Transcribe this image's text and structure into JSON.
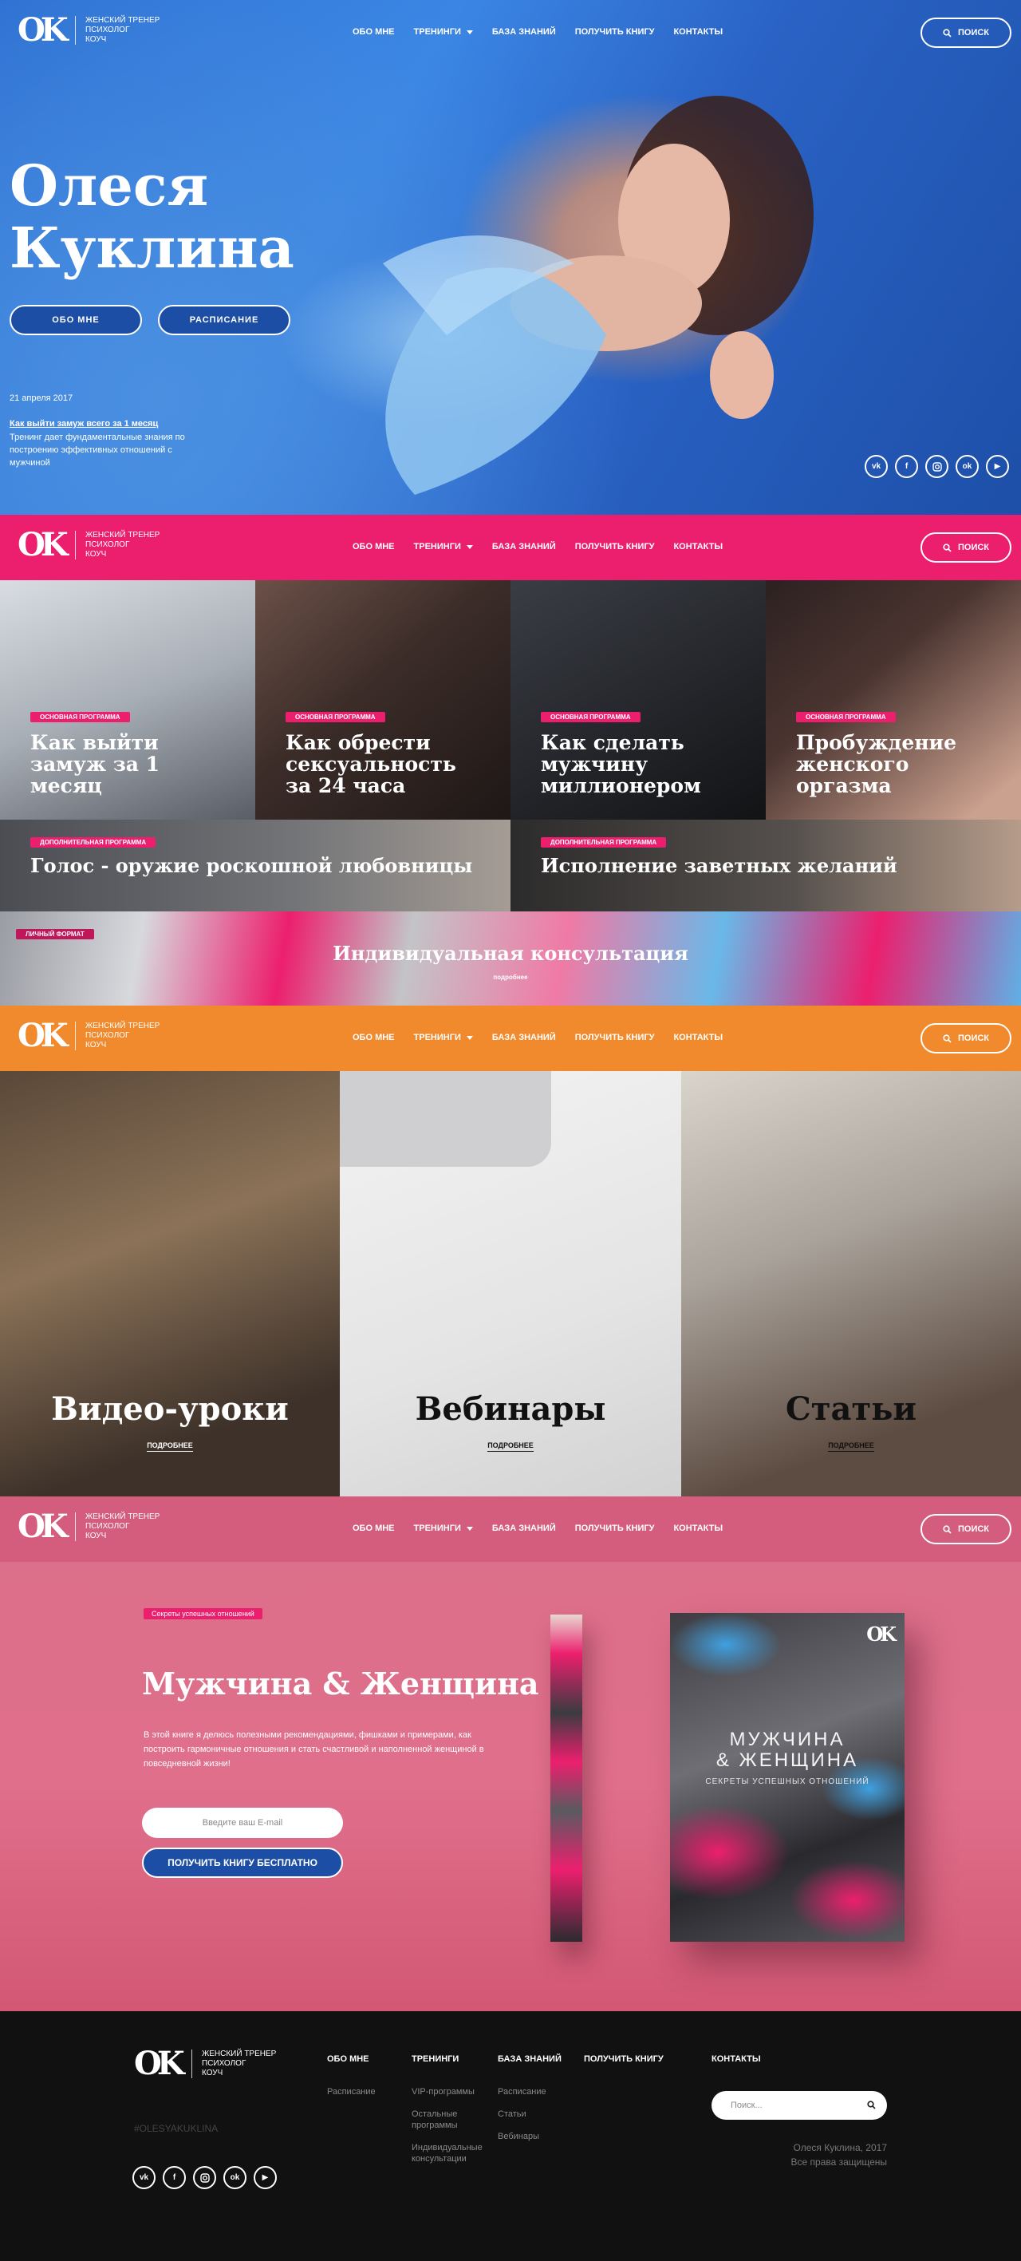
{
  "header": {
    "logo": "OK",
    "logo_lines": [
      "Женский тренер",
      "психолог",
      "коуч"
    ],
    "nav": [
      "Обо мне",
      "Тренинги",
      "База знаний",
      "Получить книгу",
      "Контакты"
    ],
    "search_label": "Поиск"
  },
  "hero": {
    "title_line1": "Олеся",
    "title_line2": "Куклина",
    "btn_about": "Обо мне",
    "btn_schedule": "Расписание",
    "date": "21 апреля 2017",
    "link": "Как выйти замуж всего за 1 месяц",
    "desc": "Тренинг дает фундаментальные знания по построению эффективных отношений с мужчиной"
  },
  "socials": [
    "vk-icon",
    "facebook-icon",
    "instagram-icon",
    "odnoklassniki-icon",
    "youtube-icon"
  ],
  "trainings": {
    "main_tag": "Основная программа",
    "extra_tag": "Дополнительная программа",
    "personal_tag": "Личный формат",
    "t1": "Как выйти замуж за 1 месяц",
    "t2": "Как обрести сексуальность за 24 часа",
    "t3": "Как сделать мужчину миллионером",
    "t4": "Пробуждение женского оргазма",
    "t5": "Голос - оружие роскошной любовницы",
    "t6": "Исполнение заветных желаний",
    "t7": "Индивидуальная консультация",
    "more": "подробнее"
  },
  "knowledge": {
    "k1": "Видео-уроки",
    "k2": "Вебинары",
    "k3": "Статьи",
    "more": "подробнее"
  },
  "book": {
    "tag": "Секреты успешных отношений",
    "title": "Мужчина & Женщина",
    "desc": "В этой книге я делюсь полезными рекомендациями, фишками и примерами, как построить гармоничные отношения и стать счастливой и наполненной женщиной в повседневной жизни!",
    "email_placeholder": "Введите ваш E-mail",
    "button": "Получить книгу бесплатно",
    "cover_title_1": "Мужчина",
    "cover_title_2": "& Женщина",
    "cover_subtitle": "Секреты успешных отношений",
    "cover_logo": "OK"
  },
  "footer": {
    "col1_head": "Обо мне",
    "col1_links": [
      "Расписание"
    ],
    "col2_head": "Тренинги",
    "col2_links": [
      "VIP-программы",
      "Остальные программы",
      "Индивидуальные консультации"
    ],
    "col3_head": "База знаний",
    "col3_links": [
      "Расписание",
      "Статьи",
      "Вебинары"
    ],
    "col4_head": "Получить книгу",
    "col5_head": "Контакты",
    "search_placeholder": "Поиск...",
    "hashtag": "#OLESYAKUKLINA",
    "copyright_1": "Олеся Куклина, 2017",
    "copyright_2": "Все права защищены"
  },
  "colors": {
    "hero_blue": "#2d6fd1",
    "pink": "#ec1f6e",
    "orange": "#f08a2c",
    "rose": "#d45d7d",
    "button_blue": "#1c4ea6",
    "footer": "#111111"
  }
}
